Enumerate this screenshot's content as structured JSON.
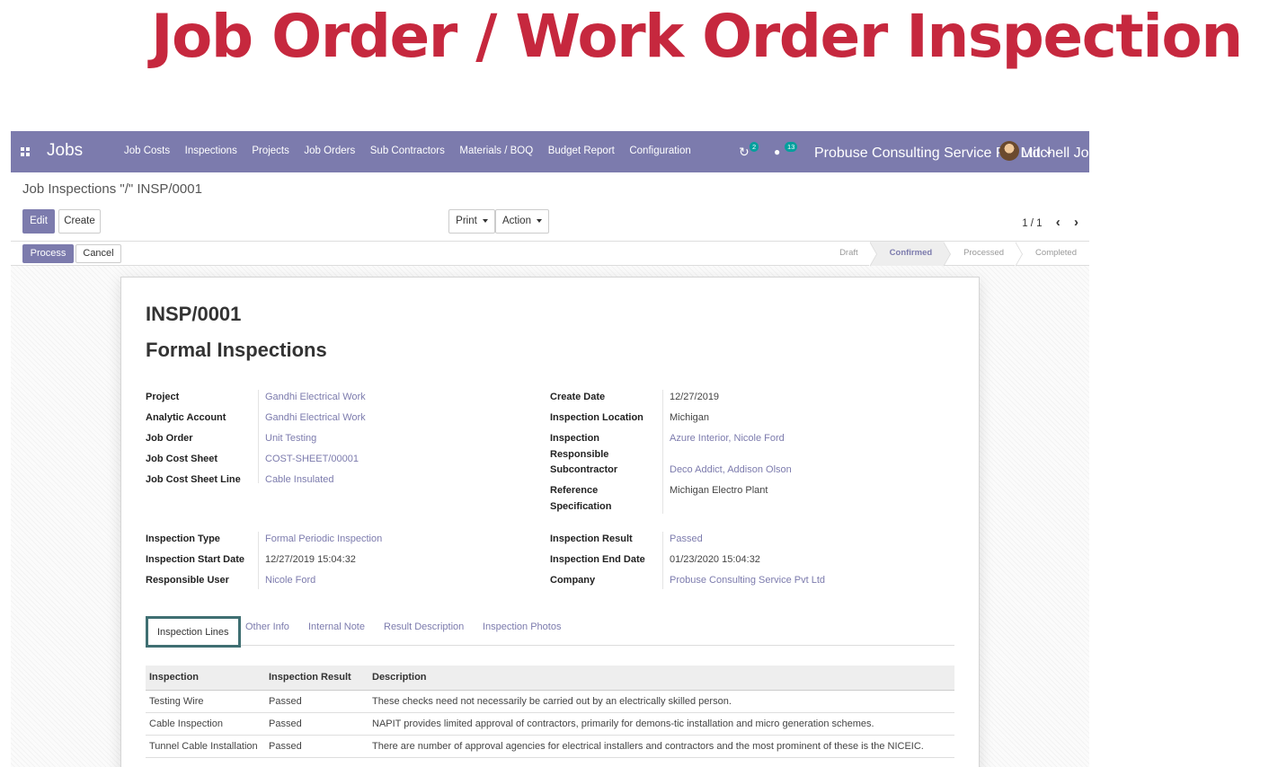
{
  "hero": {
    "title": "Job Order / Work Order Inspection"
  },
  "navbar": {
    "brand": "Jobs",
    "menu": [
      "Job Costs",
      "Inspections",
      "Projects",
      "Job Orders",
      "Sub Contractors",
      "Materials / BOQ",
      "Budget Report",
      "Configuration"
    ],
    "activity_count": "2",
    "messages_count": "13",
    "company": "Probuse Consulting Service Pvt Ltd",
    "user": "Mitchell John"
  },
  "breadcrumb": "Job Inspections \"/\" INSP/0001",
  "buttons": {
    "edit": "Edit",
    "create": "Create",
    "print": "Print",
    "action": "Action",
    "process": "Process",
    "cancel": "Cancel"
  },
  "pager": "1 / 1",
  "stages": [
    "Draft",
    "Confirmed",
    "Processed",
    "Completed"
  ],
  "active_stage": "Confirmed",
  "record": {
    "name": "INSP/0001",
    "subtitle": "Formal Inspections",
    "left_fields": [
      {
        "label": "Project",
        "value": "Gandhi Electrical Work"
      },
      {
        "label": "Analytic Account",
        "value": "Gandhi Electrical Work"
      },
      {
        "label": "Job Order",
        "value": "Unit Testing"
      },
      {
        "label": "Job Cost Sheet",
        "value": "COST-SHEET/00001"
      },
      {
        "label": "Job Cost Sheet Line",
        "value": "Cable Insulated"
      }
    ],
    "right_fields": {
      "create_date_label": "Create Date",
      "create_date": "12/27/2019",
      "location_label": "Inspection Location",
      "location": "Michigan",
      "responsible_label_1": "Inspection",
      "responsible_label_2": "Responsible",
      "responsible": "Azure Interior, Nicole Ford",
      "subcontractor_label": "Subcontractor",
      "subcontractor": "Deco Addict, Addison Olson",
      "ref_label_1": "Reference",
      "ref_label_2": "Specification",
      "reference": "Michigan Electro Plant"
    },
    "left_fields_2": [
      {
        "label": "Inspection Type",
        "value": "Formal Periodic Inspection"
      },
      {
        "label": "Inspection Start Date",
        "value": "12/27/2019 15:04:32"
      },
      {
        "label": "Responsible User",
        "value": "Nicole Ford"
      }
    ],
    "right_fields_2": [
      {
        "label": "Inspection Result",
        "value": "Passed"
      },
      {
        "label": "Inspection End Date",
        "value": "01/23/2020 15:04:32"
      },
      {
        "label": "Company",
        "value": "Probuse Consulting Service Pvt Ltd"
      }
    ]
  },
  "tabs": [
    "Inspection Lines",
    "Other Info",
    "Internal Note",
    "Result Description",
    "Inspection Photos"
  ],
  "lines": {
    "headers": [
      "Inspection",
      "Inspection Result",
      "Description"
    ],
    "rows": [
      [
        "Testing Wire",
        "Passed",
        "These checks need not necessarily be carried out by an electrically skilled person."
      ],
      [
        "Cable Inspection",
        "Passed",
        "NAPIT provides limited approval of contractors, primarily for demons-tic installation and micro generation schemes."
      ],
      [
        "Tunnel Cable Installation",
        "Passed",
        "There are number of approval agencies for electrical installers and contractors and the most prominent of these is the NICEIC."
      ]
    ]
  },
  "colors": {
    "hero": "#c6283e",
    "navbar": "#7c7bad",
    "link": "#7c7bad",
    "tab_border": "#3f6f72"
  }
}
